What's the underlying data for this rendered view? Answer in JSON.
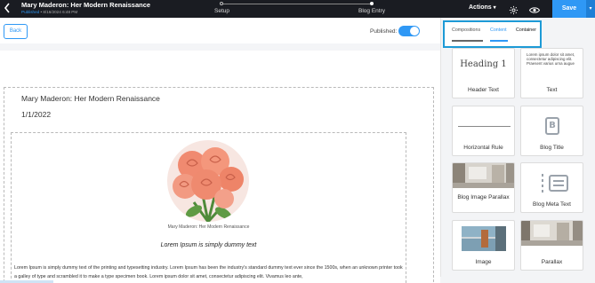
{
  "header": {
    "title": "Mary Maderon: Her Modern Renaissance",
    "status": "Published",
    "date": "8/16/2024 6:48 PM",
    "steps": [
      "Setup",
      "Blog Entry"
    ],
    "actions_label": "Actions",
    "save_label": "Save",
    "accent_color": "#2f98f5"
  },
  "toolbar": {
    "back_label": "Back",
    "published_label": "Published:",
    "published_on": true
  },
  "post": {
    "title": "Mary Maderon: Her Modern Renaissance",
    "date": "1/1/2022",
    "image_caption": "Mary Maderon: Her Modern Renaissance",
    "subheading": "Lorem Ipsum is simply dummy text",
    "body": "Lorem Ipsum is simply dummy text of the printing and typesetting industry. Lorem Ipsum has been the industry's standard dummy text ever since the 1500s, when an unknown printer took a galley of type and scrambled it to make a type specimen book. Lorem ipsum dolor sit amet, consectetur adipiscing elit. Vivamus leo ante,"
  },
  "panel": {
    "tabs": [
      {
        "label": "Compositions"
      },
      {
        "label": "Content",
        "active": true
      },
      {
        "label": "Container"
      }
    ],
    "cards": [
      {
        "label": "Header Text",
        "preview": "Heading 1"
      },
      {
        "label": "Text",
        "preview": "Lorem ipsum dolor sit amet, consectetur adipiscing elit. Praesent varius urna augue"
      },
      {
        "label": "Horizontal Rule"
      },
      {
        "label": "Blog Title",
        "icon": "blog-title-icon"
      },
      {
        "label": "Blog Image Parallax"
      },
      {
        "label": "Blog Meta Text",
        "icon": "meta-text-icon"
      },
      {
        "label": "Image"
      },
      {
        "label": "Parallax"
      }
    ]
  }
}
